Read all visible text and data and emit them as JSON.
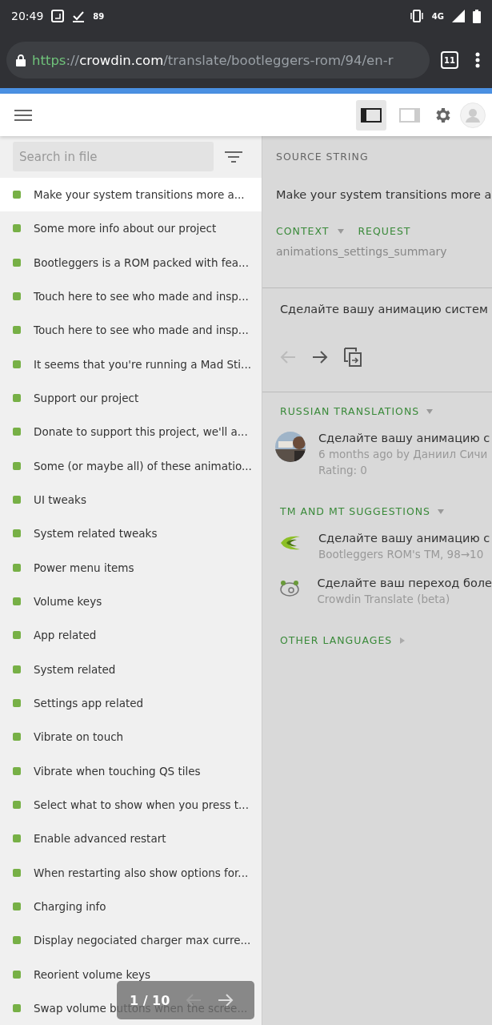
{
  "status_bar": {
    "time": "20:49",
    "notification_count": "89",
    "network": "4G"
  },
  "browser": {
    "scheme": "https",
    "separator": "://",
    "host": "crowdin.com",
    "path": "/translate/bootleggers-rom/94/en-r",
    "tab_count": "11"
  },
  "toolbar": {
    "layout_buttons": [
      {
        "kind": "sidebar",
        "selected": true
      },
      {
        "kind": "panel",
        "selected": false
      }
    ]
  },
  "sidebar": {
    "search": {
      "placeholder": "Search in file"
    },
    "items": [
      {
        "label": "Make your system transitions more a...",
        "selected": true
      },
      {
        "label": "Some more info about our project",
        "selected": false
      },
      {
        "label": "Bootleggers is a ROM packed with fea...",
        "selected": false
      },
      {
        "label": "Touch here to see who made and insp...",
        "selected": false
      },
      {
        "label": "Touch here to see who made and insp...",
        "selected": false
      },
      {
        "label": "It seems that you're running a Mad Sti...",
        "selected": false
      },
      {
        "label": "Support our project",
        "selected": false
      },
      {
        "label": "Donate to support this project, we'll a...",
        "selected": false
      },
      {
        "label": "Some (or maybe all) of these animatio...",
        "selected": false
      },
      {
        "label": "UI tweaks",
        "selected": false
      },
      {
        "label": "System related tweaks",
        "selected": false
      },
      {
        "label": "Power menu items",
        "selected": false
      },
      {
        "label": "Volume keys",
        "selected": false
      },
      {
        "label": "App related",
        "selected": false
      },
      {
        "label": "System related",
        "selected": false
      },
      {
        "label": "Settings app related",
        "selected": false
      },
      {
        "label": "Vibrate on touch",
        "selected": false
      },
      {
        "label": "Vibrate when touching QS tiles",
        "selected": false
      },
      {
        "label": "Select what to show when you press t...",
        "selected": false
      },
      {
        "label": "Enable advanced restart",
        "selected": false
      },
      {
        "label": "When restarting also show options for...",
        "selected": false
      },
      {
        "label": "Charging info",
        "selected": false
      },
      {
        "label": "Display negociated charger max curre...",
        "selected": false
      },
      {
        "label": "Reorient volume keys",
        "selected": false
      },
      {
        "label": "Swap volume buttons when the scree...",
        "selected": false
      }
    ],
    "pager": {
      "text": "1 / 10"
    }
  },
  "editor": {
    "source_heading": "SOURCE STRING",
    "source_text": "Make your system transitions more a",
    "context_tab": "CONTEXT",
    "request_tab": "REQUEST",
    "context_key": "animations_settings_summary",
    "translation": "Сделайте вашу анимацию систем",
    "sections": [
      {
        "title": "RUSSIAN TRANSLATIONS",
        "expanded": true,
        "entries": [
          {
            "kind": "user",
            "text": "Сделайте вашу анимацию с",
            "meta": "6 months ago by Даниил Сичи",
            "rating": "Rating: 0"
          }
        ]
      },
      {
        "title": "TM AND MT SUGGESTIONS",
        "expanded": true,
        "entries": [
          {
            "kind": "tm",
            "text": "Сделайте вашу анимацию с",
            "meta": "Bootleggers ROM's TM, 98→10"
          },
          {
            "kind": "mt",
            "text": "Сделайте ваш переход боле",
            "meta": "Crowdin Translate (beta)"
          }
        ]
      },
      {
        "title": "OTHER LANGUAGES",
        "expanded": false
      }
    ]
  }
}
